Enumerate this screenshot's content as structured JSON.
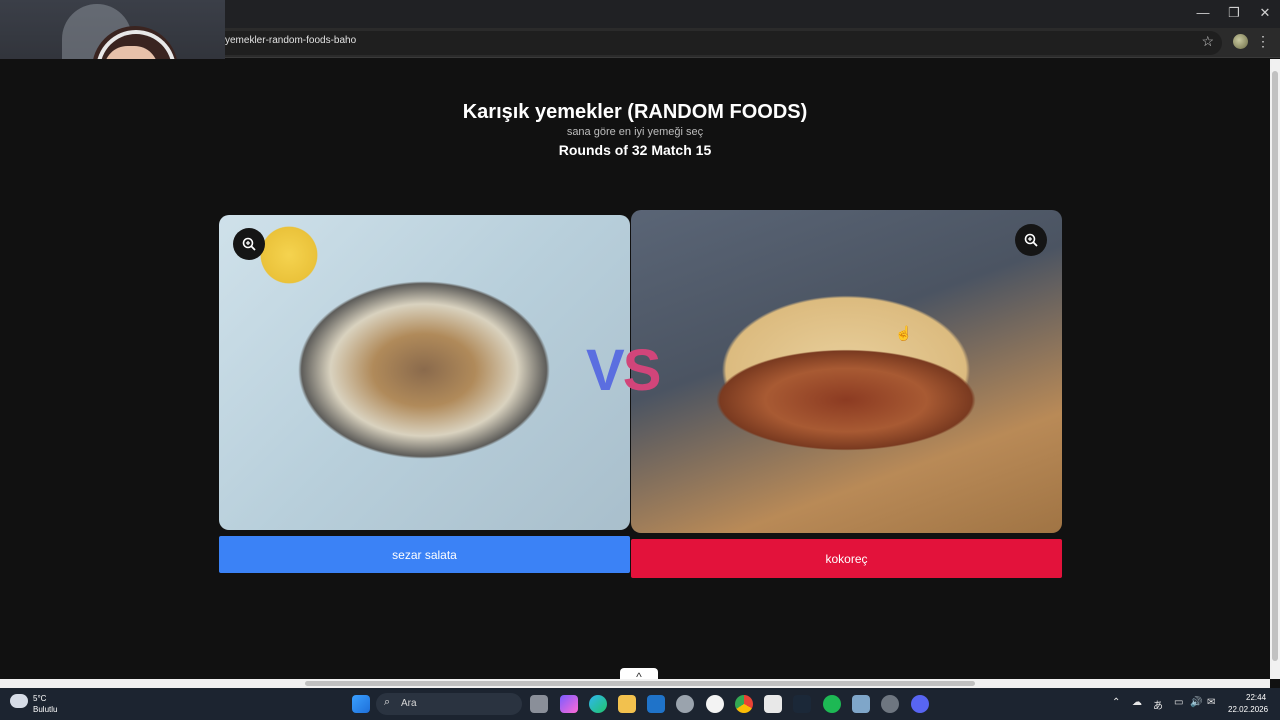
{
  "browser": {
    "url": "yemekler-random-foods-baho",
    "minimize": "—",
    "restore": "❐",
    "close": "✕"
  },
  "page": {
    "title": "Karışık yemekler (RANDOM FOODS)",
    "subtitle": "sana göre en iyi yemeği seç",
    "round_info": "Rounds of 32 Match 15",
    "vs_v": "V",
    "vs_s": "S",
    "scroll_up": "^"
  },
  "choices": {
    "left_label": "sezar salata",
    "right_label": "kokoreç"
  },
  "colors": {
    "left_button": "#3b82f6",
    "right_button": "#e3123b",
    "vs_v": "#5b6ee0",
    "vs_s": "#d1457a"
  },
  "taskbar": {
    "weather_temp": "5°C",
    "weather_desc": "Bulutlu",
    "search_label": "Ara",
    "time": "22:44",
    "date": "22.02.2026"
  }
}
